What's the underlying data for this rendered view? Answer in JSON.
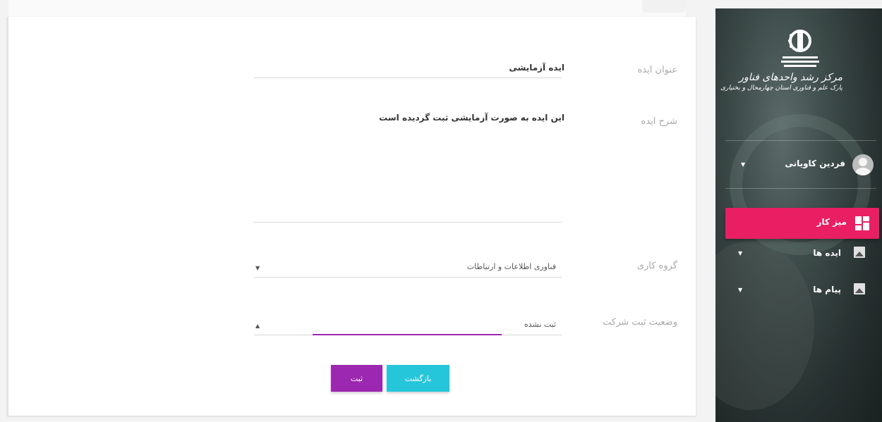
{
  "form": {
    "idea_title_label": "عنوان ایده",
    "idea_title_value": "ایده آزمایشی",
    "idea_desc_label": "شرح ایده",
    "idea_desc_value": "این ایده به صورت آزمایشی ثبت گردیده است",
    "workgroup_label": "گروه کاری",
    "workgroup_value": "فناوری اطلاعات و ارتباطات",
    "company_status_label": "وضعیت ثبت شرکت",
    "company_status_value": "ثبت نشده",
    "back_button": "بازگشت",
    "submit_button": "ثبت"
  },
  "sidebar": {
    "logo_line1": "مرکز رشد واحدهای فناور",
    "logo_line2": "پارک علم و فناوری استان چهارمحال و بختیاری",
    "user_name": "فردین کاویانی",
    "items": [
      {
        "label": "میز کار",
        "icon": "dashboard-icon",
        "active": true
      },
      {
        "label": "ایده ها",
        "icon": "image-icon",
        "active": false
      },
      {
        "label": "پیام ها",
        "icon": "image-icon",
        "active": false
      }
    ]
  },
  "colors": {
    "active_nav": "#e91e63",
    "back_button": "#26c6da",
    "submit_button": "#9c27b0",
    "focus_underline": "#9c27b0"
  }
}
